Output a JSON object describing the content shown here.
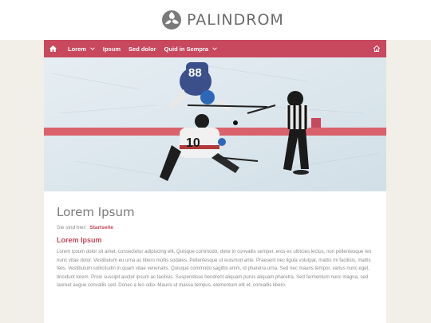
{
  "brand": {
    "name": "PALINDROM",
    "accent": "#c8485e"
  },
  "nav": {
    "home_icon": "home-icon",
    "items": [
      {
        "label": "Lorem",
        "has_dropdown": true
      },
      {
        "label": "Ipsum",
        "has_dropdown": false
      },
      {
        "label": "Sed dolor",
        "has_dropdown": false
      },
      {
        "label": "Quid in Sempra",
        "has_dropdown": true
      }
    ],
    "right_icon": "sitemap-icon"
  },
  "hero": {
    "image": "ice-hockey-faceoff-photo",
    "jersey_numbers": [
      "88",
      "10"
    ]
  },
  "page": {
    "title": "Lorem Ipsum",
    "breadcrumb_prefix": "Sie sind hier:",
    "breadcrumb_link": "Startseite",
    "section_title": "Lorem Ipsum",
    "body": "Lorem ipsum dolor sit amet, consectetur adipiscing elit. Quisque commodo, dolor in convallis semper, eros ex ultricies lectus, non pellentesque leo nunc vitae dolor. Vestibulum eu urna ac libero mollis sodales. Pellentesque ut euismod ante. Praesent nec ligula volutpat, mattis mi facilisis, mattis felis. Vestibulum sollicitudin in quam vitae venenatis. Quisque commodo sagittis enim, id pharetra urna. Sed nec mauris tempor, varius nunc eget, tincidunt lorem. Proin suscipit auctor ipsum ac facilisis. Suspendisse hendrerit aliquam purus aliquam pharetra. Sed fermentum nunc magna, sed laoreet augue convallis sed. Donec a leo odio. Mauris ut massa tempus, elementum elit et, convallis libero."
  }
}
